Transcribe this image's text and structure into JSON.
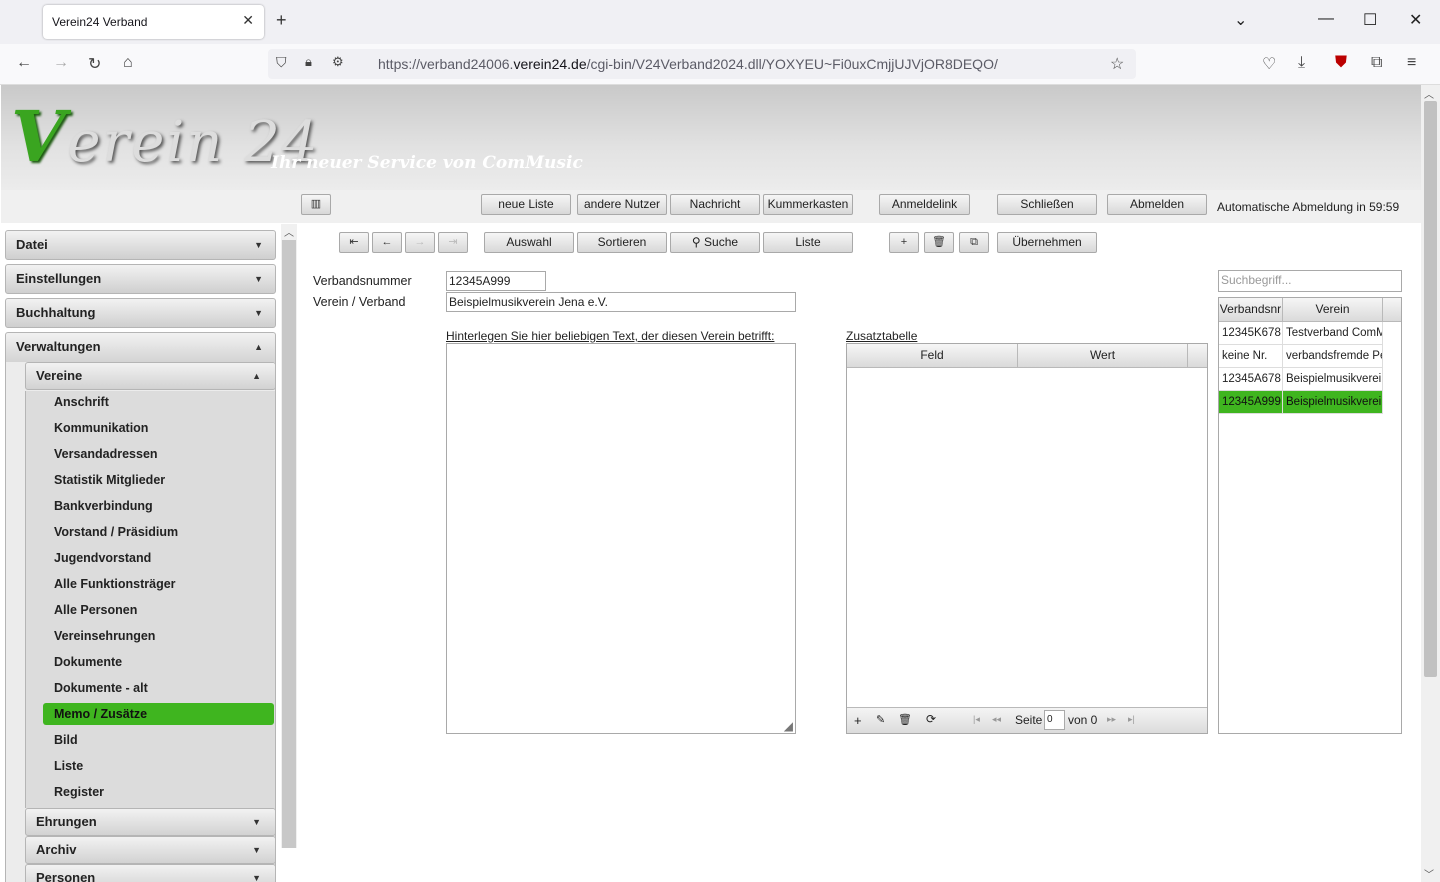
{
  "browser": {
    "tab_title": "Verein24 Verband",
    "url_prefix": "https://verband24006.",
    "url_domain": "verein24.de",
    "url_path": "/cgi-bin/V24Verband2024.dll/YOXYEU~Fi0uxCmjjUJVjOR8DEQO/"
  },
  "header": {
    "logo_v": "V",
    "logo_rest": "erein 24",
    "slogan": "Ihr neuer Service von ComMusic"
  },
  "toolbar": {
    "neue_liste": "neue Liste",
    "andere_nutzer": "andere Nutzer",
    "nachricht": "Nachricht",
    "kummerkasten": "Kummerkasten",
    "anmeldelink": "Anmeldelink",
    "schliessen": "Schließen",
    "abmelden": "Abmelden",
    "autologout": "Automatische Abmeldung in 59:59"
  },
  "sidebar": {
    "sections": [
      "Datei",
      "Einstellungen",
      "Buchhaltung",
      "Verwaltungen"
    ],
    "sub_vereine": "Vereine",
    "items": [
      "Anschrift",
      "Kommunikation",
      "Versandadressen",
      "Statistik Mitglieder",
      "Bankverbindung",
      "Vorstand / Präsidium",
      "Jugendvorstand",
      "Alle Funktionsträger",
      "Alle Personen",
      "Vereinsehrungen",
      "Dokumente",
      "Dokumente - alt",
      "Memo / Zusätze",
      "Bild",
      "Liste",
      "Register"
    ],
    "selected_item": "Memo / Zusätze",
    "sub_after": [
      "Ehrungen",
      "Archiv",
      "Personen"
    ]
  },
  "actions": {
    "auswahl": "Auswahl",
    "sortieren": "Sortieren",
    "suche": "Suche",
    "liste": "Liste",
    "uebernehmen": "Übernehmen"
  },
  "form": {
    "verbandsnummer_label": "Verbandsnummer",
    "verbandsnummer_value": "12345A999",
    "verein_label": "Verein / Verband",
    "verein_value": "Beispielmusikverein Jena e.V.",
    "memo_label": "Hinterlegen Sie hier beliebigen Text, der diesen Verein betrifft:",
    "memo_value": "",
    "zusatz_label": "Zusatztabelle",
    "zusatz_columns": [
      "Feld",
      "Wert"
    ],
    "pager_seite": "Seite",
    "pager_value": "0",
    "pager_von": "von 0"
  },
  "search": {
    "placeholder": "Suchbegriff..."
  },
  "list": {
    "columns": [
      "Verbandsnr",
      "Verein"
    ],
    "rows": [
      [
        "12345K678",
        "Testverband ComMusic"
      ],
      [
        "keine Nr.",
        "verbandsfremde Personen"
      ],
      [
        "12345A678",
        "Beispielmusikverein"
      ],
      [
        "12345A999",
        "Beispielmusikverein"
      ]
    ],
    "selected_row": 3
  },
  "colors": {
    "accent": "#3fb51f",
    "header_bg": "#d9d9d9"
  }
}
